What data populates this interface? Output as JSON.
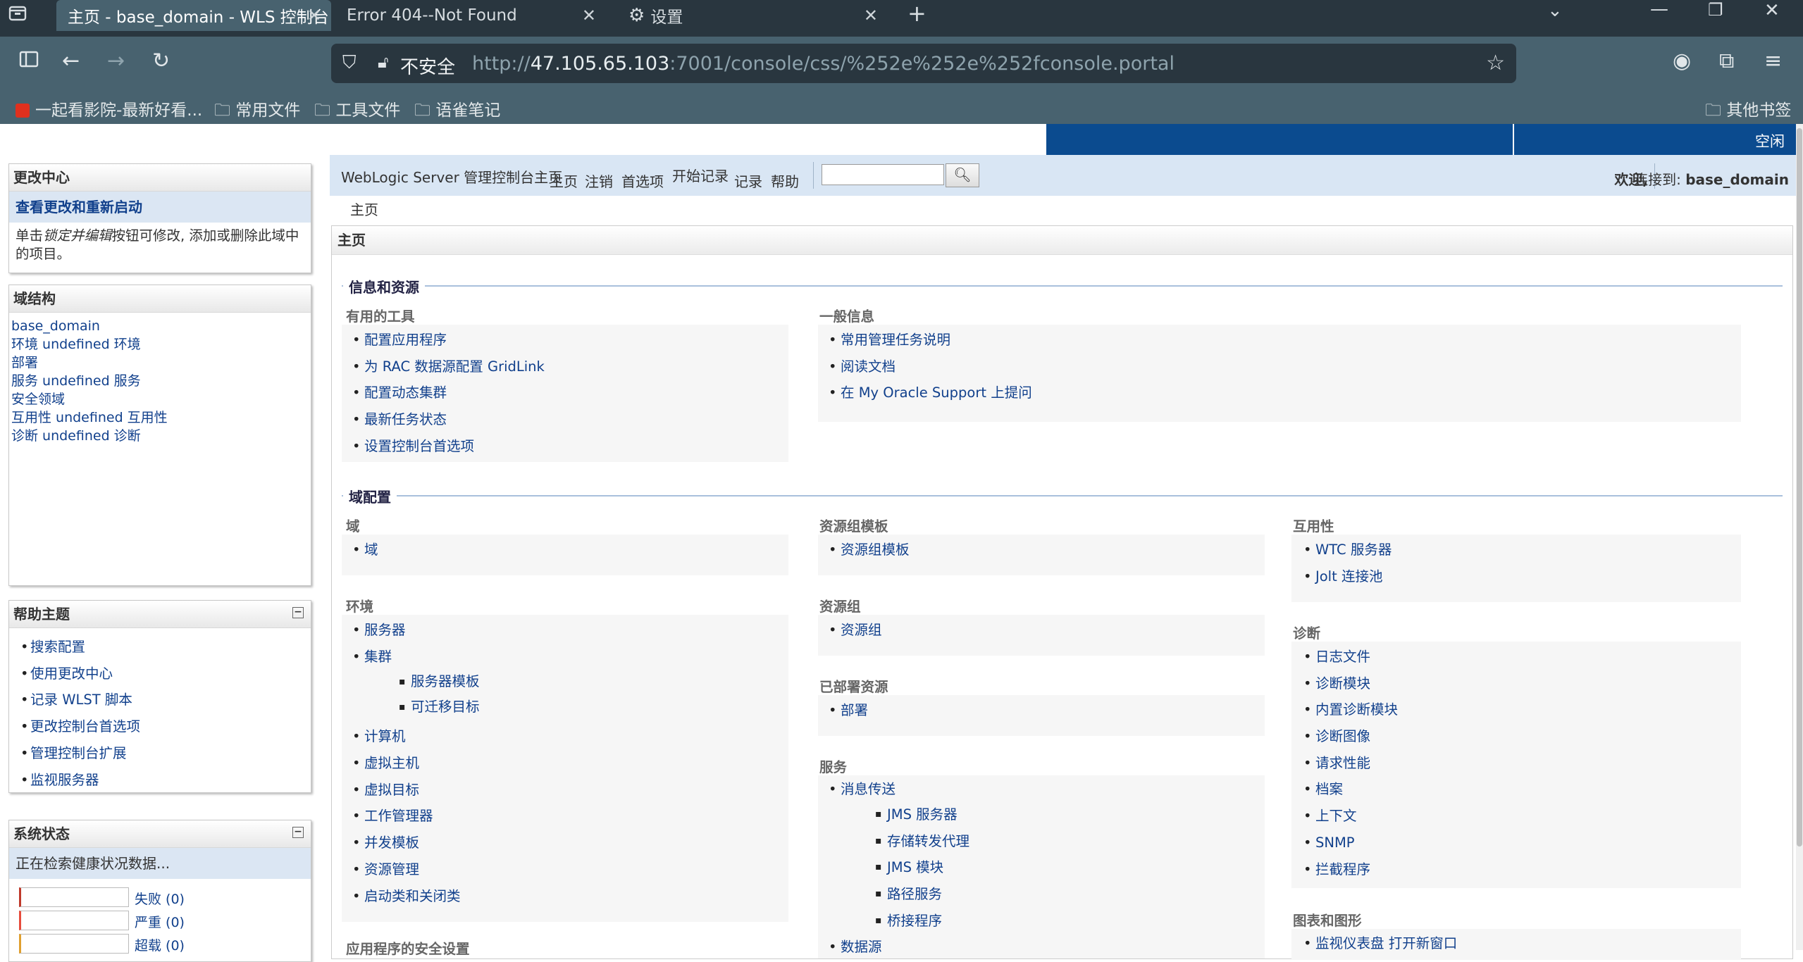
{
  "browser": {
    "tabs": [
      {
        "label": "主页 - base_domain - WLS 控制台"
      },
      {
        "label": "Error 404--Not Found"
      },
      {
        "label": "设置"
      }
    ],
    "security_label": "不安全",
    "url_prefix": "http://",
    "url_host": "47.105.65.103",
    "url_rest": ":7001/console/css/%252e%252e%252fconsole.portal",
    "bookmarks": [
      "一起看影院-最新好看...",
      "常用文件",
      "工具文件",
      "语雀笔记"
    ],
    "other_bookmarks": "其他书签",
    "icons": [
      "tab-manager-icon",
      "sidebar-icon",
      "back-arrow-icon",
      "forward-arrow-icon",
      "reload-icon",
      "shield-icon",
      "lock-warning-icon",
      "star-icon",
      "account-icon",
      "extensions-icon",
      "menu-icon",
      "folder-icon",
      "chevron-down-icon",
      "minimize-icon",
      "restore-icon",
      "close-icon",
      "plus-icon",
      "gear-icon"
    ]
  },
  "status_bar": {
    "idle": "空闲"
  },
  "main_nav": {
    "home_title": "WebLogic Server 管理控制台主页",
    "links": [
      "主页",
      "注销",
      "首选项",
      "开始记录",
      "记录",
      "帮助"
    ],
    "search_placeholder": "",
    "welcome": "欢迎,",
    "connected_label": "连接到:",
    "domain": "base_domain"
  },
  "breadcrumb": "主页",
  "change_center": {
    "title": "更改中心",
    "view_link": "查看更改和重新启动",
    "desc_prefix": "单击",
    "desc_em": "锁定并编辑",
    "desc_suffix": "按钮可修改, 添加或删除此域中的项目。"
  },
  "domain_structure": {
    "title": "域结构",
    "items": [
      "base_domain",
      "环境 undefined 环境",
      "部署",
      "服务 undefined 服务",
      "安全领域",
      "互用性 undefined 互用性",
      "诊断 undefined 诊断"
    ]
  },
  "help_topics": {
    "title": "帮助主题",
    "items": [
      "搜索配置",
      "使用更改中心",
      "记录 WLST 脚本",
      "更改控制台首选项",
      "管理控制台扩展",
      "监视服务器"
    ]
  },
  "system_status": {
    "title": "系统状态",
    "loading": "正在检索健康状况数据...",
    "rows": [
      {
        "label": "失败 (0)",
        "color": "#c0392b"
      },
      {
        "label": "严重 (0)",
        "color": "#e74c3c"
      },
      {
        "label": "超载 (0)",
        "color": "#e0a030"
      }
    ]
  },
  "content": {
    "title": "主页",
    "sections": {
      "info": "信息和资源",
      "domain_config": "域配置"
    },
    "useful_tools": {
      "title": "有用的工具",
      "items": [
        "配置应用程序",
        "为 RAC 数据源配置 GridLink",
        "配置动态集群",
        "最新任务状态",
        "设置控制台首选项"
      ]
    },
    "general_info": {
      "title": "一般信息",
      "items": [
        "常用管理任务说明",
        "阅读文档",
        "在 My Oracle Support 上提问"
      ]
    },
    "domain_group": {
      "title": "域",
      "items": [
        "域"
      ]
    },
    "environment": {
      "title": "环境",
      "items": [
        "服务器",
        "集群",
        "服务器模板",
        "可迁移目标",
        "计算机",
        "虚拟主机",
        "虚拟目标",
        "工作管理器",
        "并发模板",
        "资源管理",
        "启动类和关闭类"
      ]
    },
    "app_security": {
      "title": "应用程序的安全设置"
    },
    "resource_group_templates": {
      "title": "资源组模板",
      "items": [
        "资源组模板"
      ]
    },
    "resource_groups": {
      "title": "资源组",
      "items": [
        "资源组"
      ]
    },
    "deployed_resources": {
      "title": "已部署资源",
      "items": [
        "部署"
      ]
    },
    "services": {
      "title": "服务",
      "items": [
        "消息传送",
        "JMS 服务器",
        "存储转发代理",
        "JMS 模块",
        "路径服务",
        "桥接程序",
        "数据源"
      ]
    },
    "interoperability": {
      "title": "互用性",
      "items": [
        "WTC 服务器",
        "Jolt 连接池"
      ]
    },
    "diagnostics": {
      "title": "诊断",
      "items": [
        "日志文件",
        "诊断模块",
        "内置诊断模块",
        "诊断图像",
        "请求性能",
        "档案",
        "上下文",
        "SNMP",
        "拦截程序"
      ]
    },
    "charts": {
      "title": "图表和图形",
      "items": [
        "监视仪表盘 打开新窗口"
      ]
    }
  }
}
